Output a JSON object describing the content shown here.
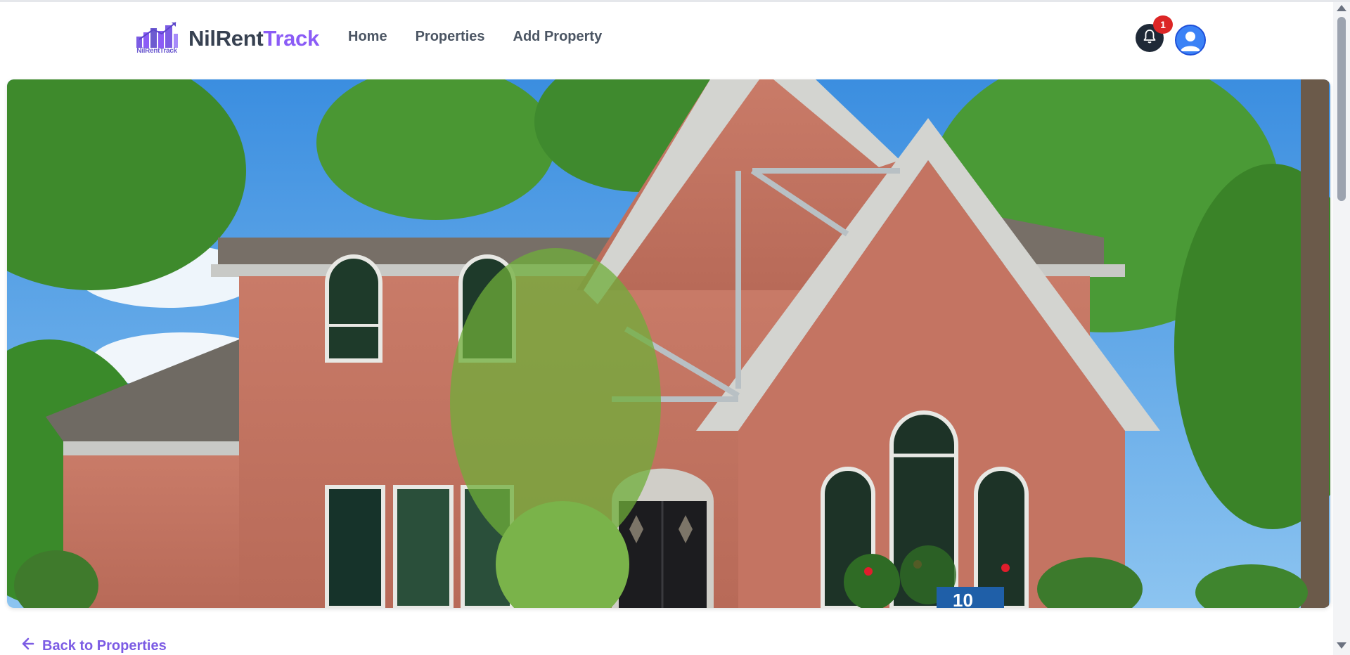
{
  "brand": {
    "logo_text": "NilRentTrack",
    "name_part1": "NilRent",
    "name_part2": "Track",
    "colors": {
      "primary": "#374151",
      "accent": "#8b5cf6"
    }
  },
  "nav": {
    "items": [
      {
        "label": "Home"
      },
      {
        "label": "Properties"
      },
      {
        "label": "Add Property"
      }
    ]
  },
  "header_actions": {
    "notifications_icon": "bell-icon",
    "notification_count": "1",
    "profile_icon": "user-avatar-icon"
  },
  "hero": {
    "image_alt": "Brick two-story house with trees",
    "house_number": "10"
  },
  "back_link": {
    "label": "Back to Properties",
    "icon": "arrow-left-icon"
  }
}
